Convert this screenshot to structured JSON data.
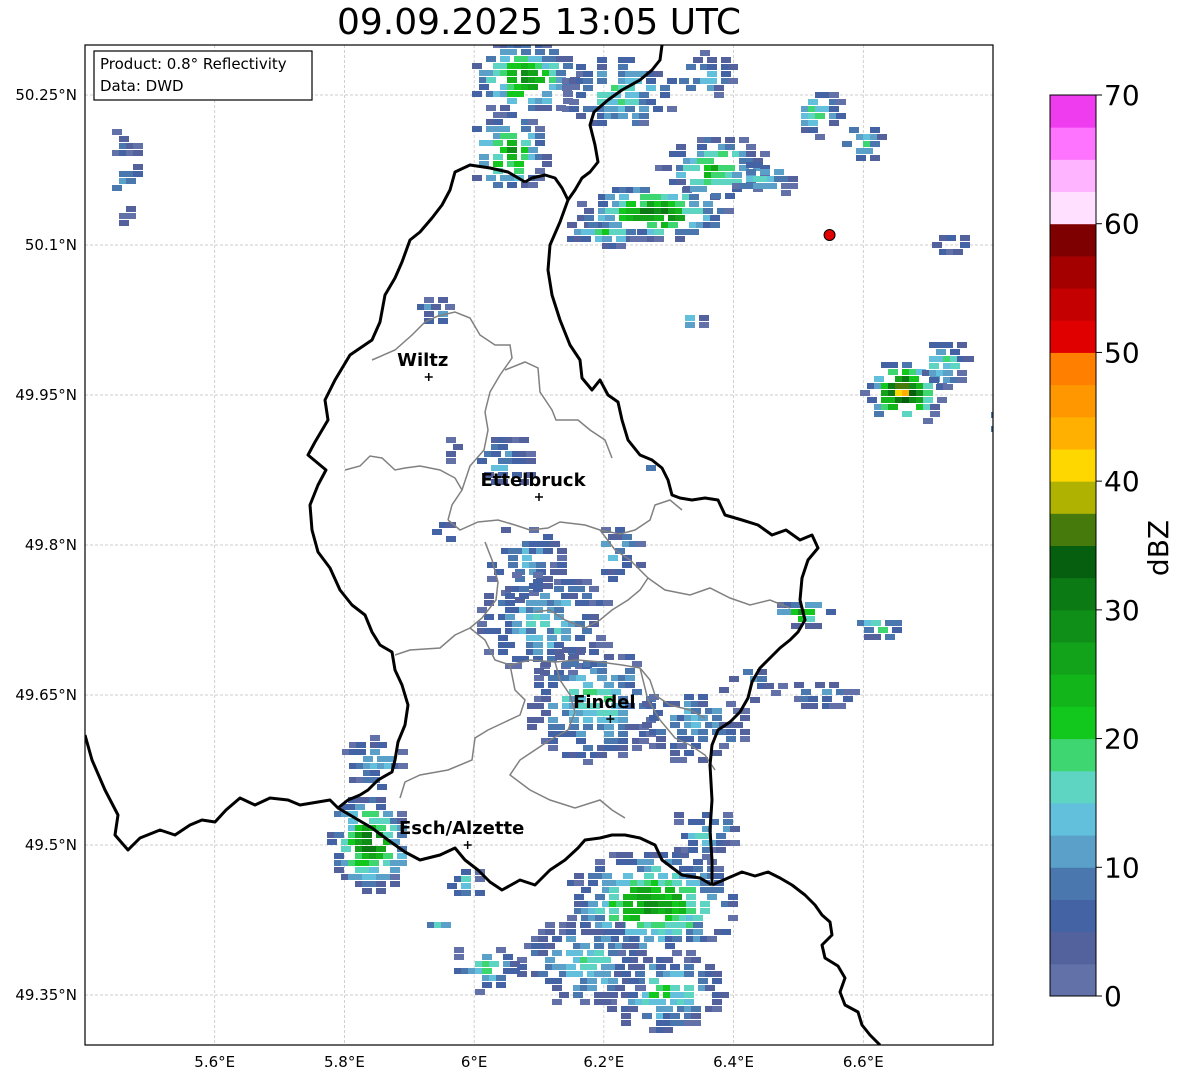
{
  "title": "09.09.2025 13:05 UTC",
  "info_box": {
    "product": "Product: 0.8° Reflectivity",
    "data": "Data: DWD"
  },
  "map": {
    "lon_range": [
      5.4,
      6.8
    ],
    "lat_range": [
      49.3,
      50.3
    ],
    "lat_ticks": [
      {
        "value": 50.25,
        "label": "50.25°N"
      },
      {
        "value": 50.1,
        "label": "50.1°N"
      },
      {
        "value": 49.95,
        "label": "49.95°N"
      },
      {
        "value": 49.8,
        "label": "49.8°N"
      },
      {
        "value": 49.65,
        "label": "49.65°N"
      },
      {
        "value": 49.5,
        "label": "49.5°N"
      },
      {
        "value": 49.35,
        "label": "49.35°N"
      }
    ],
    "lon_ticks": [
      {
        "value": 5.6,
        "label": "5.6°E"
      },
      {
        "value": 5.8,
        "label": "5.8°E"
      },
      {
        "value": 6.0,
        "label": "6°E"
      },
      {
        "value": 6.2,
        "label": "6.2°E"
      },
      {
        "value": 6.4,
        "label": "6.4°E"
      },
      {
        "value": 6.6,
        "label": "6.6°E"
      }
    ],
    "grid": true,
    "cities": [
      {
        "name": "Wiltz",
        "lon": 5.93,
        "lat": 49.968
      },
      {
        "name": "Ettelbruck",
        "lon": 6.1,
        "lat": 49.848
      },
      {
        "name": "Findel",
        "lon": 6.21,
        "lat": 49.626
      },
      {
        "name": "Esch/Alzette",
        "lon": 5.99,
        "lat": 49.5
      }
    ],
    "radar_site": {
      "lon": 6.548,
      "lat": 50.11,
      "color": "#e00000"
    }
  },
  "colorbar": {
    "label": "dBZ",
    "min": 0,
    "max": 70,
    "step": 2.5,
    "ticks": [
      "0",
      "10",
      "20",
      "30",
      "40",
      "50",
      "60",
      "70"
    ],
    "colors": [
      "#6272a8",
      "#53629c",
      "#4463a5",
      "#4b77af",
      "#5aa0c8",
      "#63c0dc",
      "#5dd5c2",
      "#3ed670",
      "#13c81d",
      "#13b61a",
      "#12a31a",
      "#0f8f17",
      "#0c7a14",
      "#065f0e",
      "#477a0d",
      "#afb200",
      "#ffd700",
      "#ffb000",
      "#ff9800",
      "#ff7f00",
      "#e00000",
      "#c40000",
      "#a40000",
      "#7e0000",
      "#ffe0ff",
      "#ffb4ff",
      "#ff74ff",
      "#ee3cee"
    ]
  }
}
